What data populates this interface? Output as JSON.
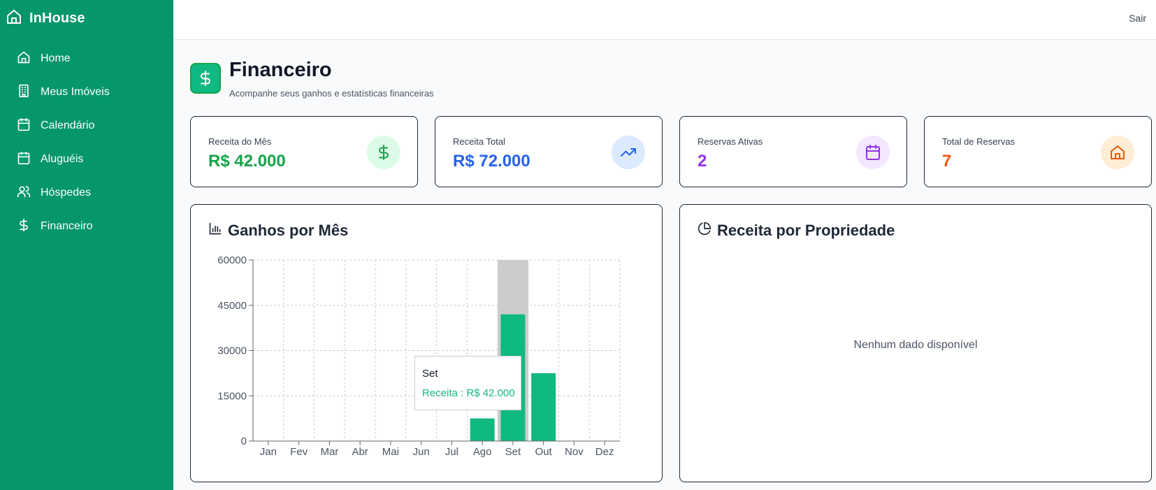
{
  "app": {
    "name": "InHouse"
  },
  "sidebar": {
    "items": [
      {
        "label": "Home",
        "icon": "home-icon"
      },
      {
        "label": "Meus Imóveis",
        "icon": "building-icon"
      },
      {
        "label": "Calendário",
        "icon": "calendar-icon"
      },
      {
        "label": "Aluguéis",
        "icon": "calendar-icon"
      },
      {
        "label": "Hóspedes",
        "icon": "users-icon"
      },
      {
        "label": "Financeiro",
        "icon": "dollar-icon"
      }
    ]
  },
  "topbar": {
    "logout_label": "Sair"
  },
  "page": {
    "title": "Financeiro",
    "subtitle": "Acompanhe seus ganhos e estatísticas financeiras"
  },
  "stats": [
    {
      "label": "Receita do Mês",
      "value": "R$ 42.000",
      "color": "#16a34a",
      "icon": "dollar-icon",
      "icon_bg": "#dcfce7"
    },
    {
      "label": "Receita Total",
      "value": "R$ 72.000",
      "color": "#2563eb",
      "icon": "trending-up-icon",
      "icon_bg": "#dbeafe"
    },
    {
      "label": "Reservas Ativas",
      "value": "2",
      "color": "#9333ea",
      "icon": "calendar-icon",
      "icon_bg": "#f3e8ff"
    },
    {
      "label": "Total de Reservas",
      "value": "7",
      "color": "#ea580c",
      "icon": "home-icon",
      "icon_bg": "#ffedd5"
    }
  ],
  "earnings_panel": {
    "title": "Ganhos por Mês"
  },
  "property_panel": {
    "title": "Receita por Propriedade",
    "empty_message": "Nenhum dado disponível"
  },
  "tooltip": {
    "title": "Set",
    "series_label": "Receita",
    "value": "R$ 42.000"
  },
  "chart_data": {
    "type": "bar",
    "categories": [
      "Jan",
      "Fev",
      "Mar",
      "Abr",
      "Mai",
      "Jun",
      "Jul",
      "Ago",
      "Set",
      "Out",
      "Nov",
      "Dez"
    ],
    "series": [
      {
        "name": "Receita",
        "values": [
          0,
          0,
          0,
          0,
          0,
          0,
          0,
          7500,
          42000,
          22500,
          0,
          0
        ],
        "color": "#10b981"
      }
    ],
    "yticks": [
      0,
      15000,
      30000,
      45000,
      60000
    ],
    "ylim": [
      0,
      60000
    ],
    "grid": true,
    "highlighted_category": "Set"
  }
}
